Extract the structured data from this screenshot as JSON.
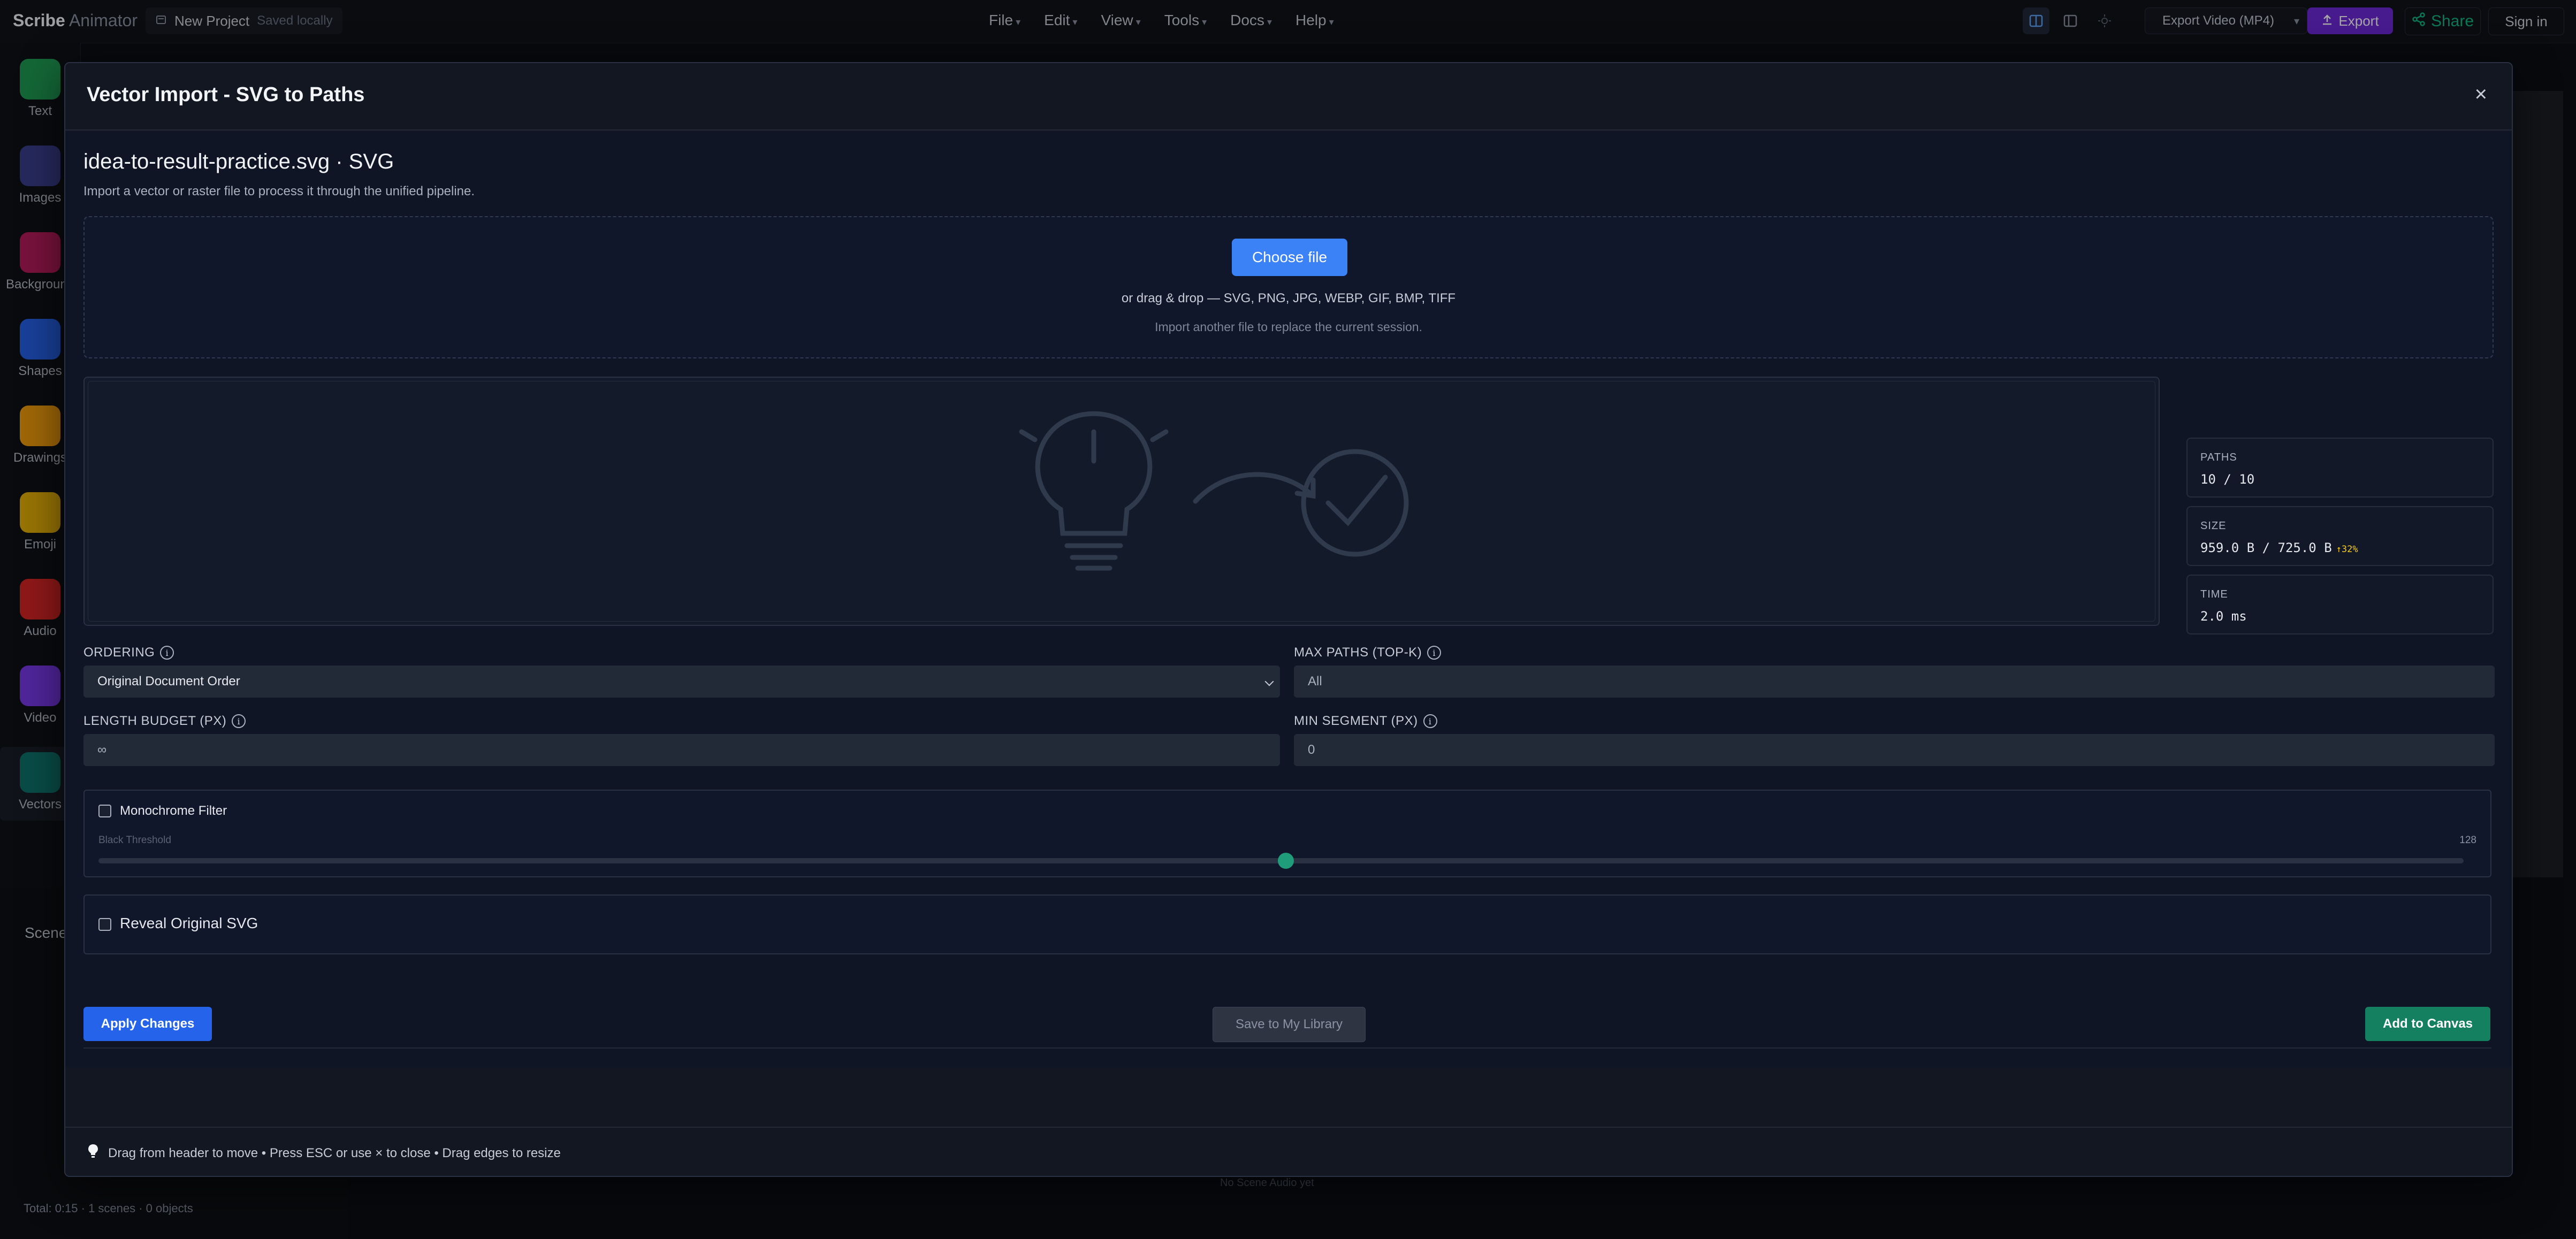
{
  "app": {
    "brand_bold": "Scribe",
    "brand_light": "Animator"
  },
  "project": {
    "name": "New Project",
    "status": "Saved locally"
  },
  "menu": [
    "File",
    "Edit",
    "View",
    "Tools",
    "Docs",
    "Help"
  ],
  "toolbar": {
    "export_select": "Export Video (MP4)",
    "export_label": "Export",
    "share_label": "Share",
    "signin_label": "Sign in"
  },
  "tools": [
    {
      "label": "Text",
      "icon": "text-tool-icon",
      "color": "#1f9d55"
    },
    {
      "label": "Images",
      "icon": "images-tool-icon",
      "color": "#3b3f8f"
    },
    {
      "label": "Background",
      "icon": "background-tool-icon",
      "color": "#b91c5c"
    },
    {
      "label": "Shapes",
      "icon": "shapes-tool-icon",
      "color": "#2563eb"
    },
    {
      "label": "Drawings",
      "icon": "drawings-tool-icon",
      "color": "#f59e0b"
    },
    {
      "label": "Emoji",
      "icon": "emoji-tool-icon",
      "color": "#eab308"
    },
    {
      "label": "Audio",
      "icon": "audio-tool-icon",
      "color": "#dc2626"
    },
    {
      "label": "Video",
      "icon": "video-tool-icon",
      "color": "#7c3aed"
    },
    {
      "label": "Vectors",
      "icon": "vectors-tool-icon",
      "color": "#0f766e"
    }
  ],
  "sidebar_bottom": {
    "scenes_label": "Scene",
    "total": "Total: 0:15 · 1 scenes · 0 objects"
  },
  "background": {
    "audio_placeholder": "No Scene Audio yet"
  },
  "modal": {
    "title": "Vector Import - SVG to Paths",
    "file_title": "idea-to-result-practice.svg · SVG",
    "file_subtitle": "Import a vector or raster file to process it through the unified pipeline.",
    "choose_file": "Choose file",
    "drop_hint": "or drag & drop — SVG, PNG, JPG, WEBP, GIF, BMP, TIFF",
    "replace_hint": "Import another file to replace the current session.",
    "stats": [
      {
        "key": "PATHS",
        "value": "10 / 10",
        "delta": ""
      },
      {
        "key": "SIZE",
        "value": "959.0 B / 725.0 B",
        "delta": "↑32%"
      },
      {
        "key": "TIME",
        "value": "2.0 ms",
        "delta": ""
      }
    ],
    "ordering": {
      "label": "ORDERING",
      "value": "Original Document Order"
    },
    "max_paths": {
      "label": "MAX PATHS (TOP-K)",
      "placeholder": "All"
    },
    "length_budget": {
      "label": "LENGTH BUDGET (PX)",
      "placeholder": "∞"
    },
    "min_segment": {
      "label": "MIN SEGMENT (PX)",
      "placeholder": "0"
    },
    "monochrome": {
      "label": "Monochrome Filter",
      "checked": false,
      "threshold_label": "Black Threshold",
      "threshold_value": "128",
      "threshold_fraction": 0.502
    },
    "reveal": {
      "label": "Reveal Original SVG",
      "checked": false
    },
    "apply_label": "Apply Changes",
    "save_label": "Save to My Library",
    "add_label": "Add to Canvas",
    "footer_hint": "Drag from header to move • Press ESC or use × to close • Drag edges to resize",
    "close_glyph": "×"
  }
}
